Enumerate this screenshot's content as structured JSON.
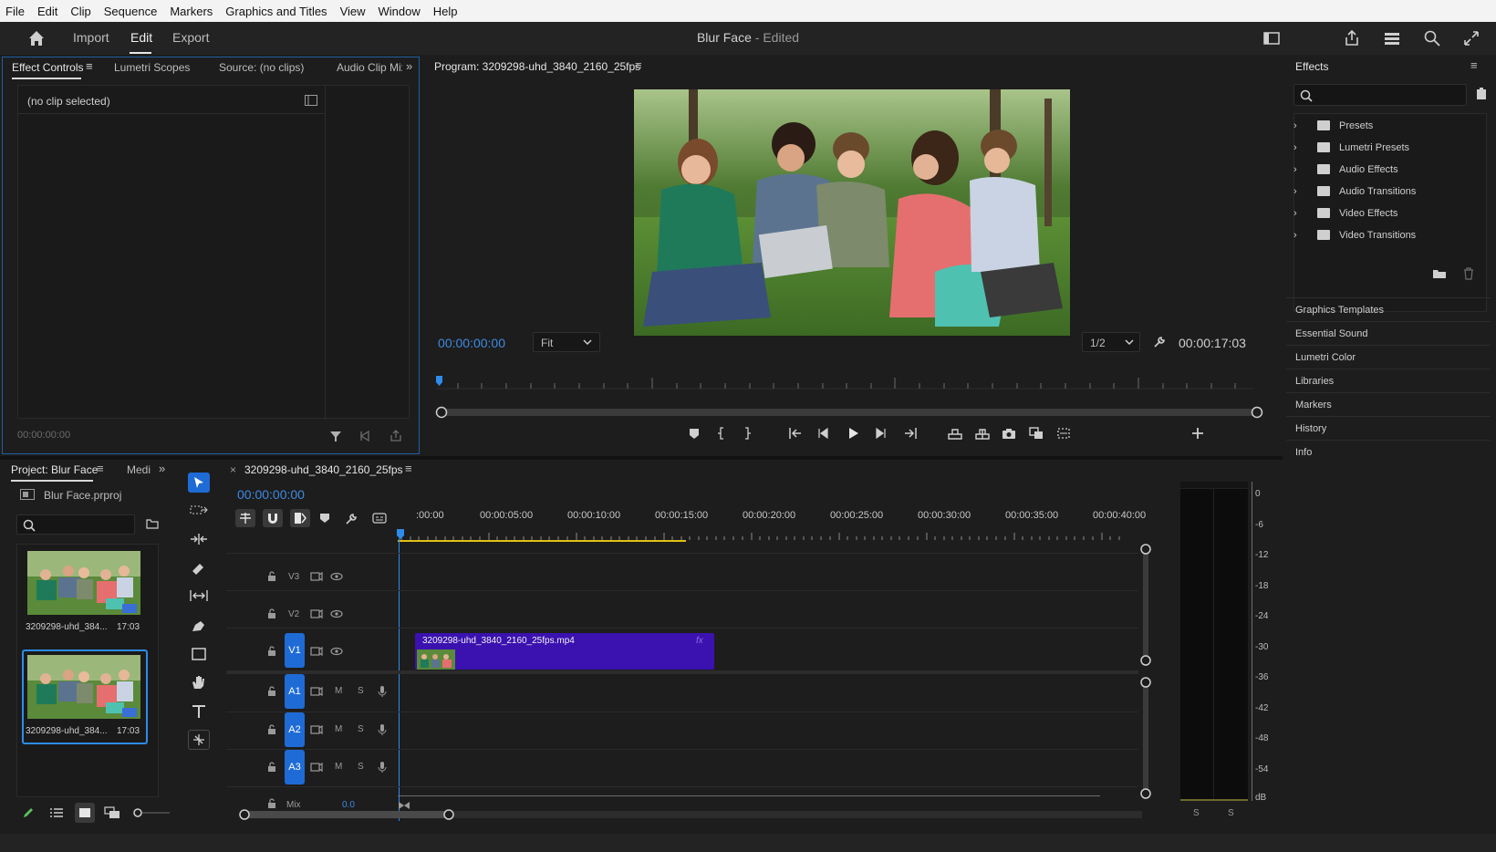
{
  "menu": [
    "File",
    "Edit",
    "Clip",
    "Sequence",
    "Markers",
    "Graphics and Titles",
    "View",
    "Window",
    "Help"
  ],
  "header": {
    "import_label": "Import",
    "edit_label": "Edit",
    "export_label": "Export",
    "project_name": "Blur Face",
    "status": " - Edited"
  },
  "effect_controls": {
    "tabs": [
      "Effect Controls",
      "Lumetri Scopes",
      "Source: (no clips)",
      "Audio Clip Mix"
    ],
    "no_clip": "(no clip selected)",
    "timecode": "00:00:00:00"
  },
  "program": {
    "title": "Program: 3209298-uhd_3840_2160_25fps",
    "timecode": "00:00:00:00",
    "fit": "Fit",
    "resolution": "1/2",
    "duration": "00:00:17:03"
  },
  "effects": {
    "title": "Effects",
    "search_placeholder": "",
    "items": [
      "Presets",
      "Lumetri Presets",
      "Audio Effects",
      "Audio Transitions",
      "Video Effects",
      "Video Transitions"
    ],
    "side_panels": [
      "Graphics Templates",
      "Essential Sound",
      "Lumetri Color",
      "Libraries",
      "Markers",
      "History",
      "Info"
    ]
  },
  "project": {
    "tab": "Project: Blur Face",
    "tab2": "Medi",
    "file": "Blur Face.prproj",
    "clips": [
      {
        "name": "3209298-uhd_384...",
        "duration": "17:03"
      },
      {
        "name": "3209298-uhd_384...",
        "duration": "17:03"
      }
    ]
  },
  "timeline": {
    "sequence": "3209298-uhd_3840_2160_25fps",
    "timecode": "00:00:00:00",
    "ruler": [
      ":00:00",
      "00:00:05:00",
      "00:00:10:00",
      "00:00:15:00",
      "00:00:20:00",
      "00:00:25:00",
      "00:00:30:00",
      "00:00:35:00",
      "00:00:40:00"
    ],
    "video_tracks": [
      "V3",
      "V2",
      "V1"
    ],
    "audio_tracks": [
      "A1",
      "A2",
      "A3"
    ],
    "mute": "M",
    "solo": "S",
    "mix_label": "Mix",
    "mix_value": "0.0",
    "clip_name": "3209298-uhd_3840_2160_25fps.mp4",
    "clip_fx": "fx"
  },
  "meter": {
    "labels": [
      "0",
      "-6",
      "-12",
      "-18",
      "-24",
      "-30",
      "-36",
      "-42",
      "-48",
      "-54",
      "dB"
    ],
    "channels": [
      "S",
      "S"
    ]
  },
  "colors": {
    "accent": "#2d8ceb",
    "clip": "#3b12b0",
    "badge": "#1f6bd6"
  }
}
